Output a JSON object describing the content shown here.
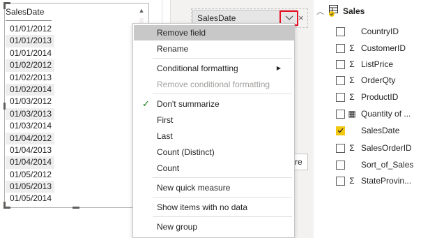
{
  "table": {
    "header": "SalesDate",
    "rows": [
      "01/01/2012",
      "01/01/2013",
      "01/01/2014",
      "01/02/2012",
      "01/02/2013",
      "01/02/2014",
      "01/03/2012",
      "01/03/2013",
      "01/03/2014",
      "01/04/2012",
      "01/04/2013",
      "01/04/2014",
      "01/05/2012",
      "01/05/2013",
      "01/05/2014"
    ]
  },
  "field_well": {
    "pill_label": "SalesDate",
    "close_glyph": "×",
    "partial_button_label": "re"
  },
  "context_menu": {
    "items": [
      {
        "label": "Remove field",
        "state": "highlighted"
      },
      {
        "label": "Rename",
        "state": "normal"
      },
      {
        "label": "Conditional formatting",
        "state": "submenu"
      },
      {
        "label": "Remove conditional formatting",
        "state": "disabled"
      },
      {
        "label": "Don't summarize",
        "state": "checked"
      },
      {
        "label": "First",
        "state": "normal"
      },
      {
        "label": "Last",
        "state": "normal"
      },
      {
        "label": "Count (Distinct)",
        "state": "normal"
      },
      {
        "label": "Count",
        "state": "normal"
      },
      {
        "label": "New quick measure",
        "state": "normal"
      },
      {
        "label": "Show items with no data",
        "state": "normal"
      },
      {
        "label": "New group",
        "state": "normal"
      }
    ]
  },
  "fields": {
    "table_name": "Sales",
    "items": [
      {
        "name": "CountryID",
        "type": "none",
        "checked": false
      },
      {
        "name": "CustomerID",
        "type": "sigma",
        "checked": false
      },
      {
        "name": "ListPrice",
        "type": "sigma",
        "checked": false
      },
      {
        "name": "OrderQty",
        "type": "sigma",
        "checked": false
      },
      {
        "name": "ProductID",
        "type": "sigma",
        "checked": false
      },
      {
        "name": "Quantity of ...",
        "type": "calculator",
        "checked": false
      },
      {
        "name": "SalesDate",
        "type": "none",
        "checked": true
      },
      {
        "name": "SalesOrderID",
        "type": "sigma",
        "checked": false
      },
      {
        "name": "Sort_of_Sales",
        "type": "none",
        "checked": false
      },
      {
        "name": "StateProvin...",
        "type": "sigma",
        "checked": false
      }
    ]
  },
  "colors": {
    "accent_yellow": "#f2c811",
    "highlight_red": "#e81123",
    "check_green": "#107c10"
  }
}
